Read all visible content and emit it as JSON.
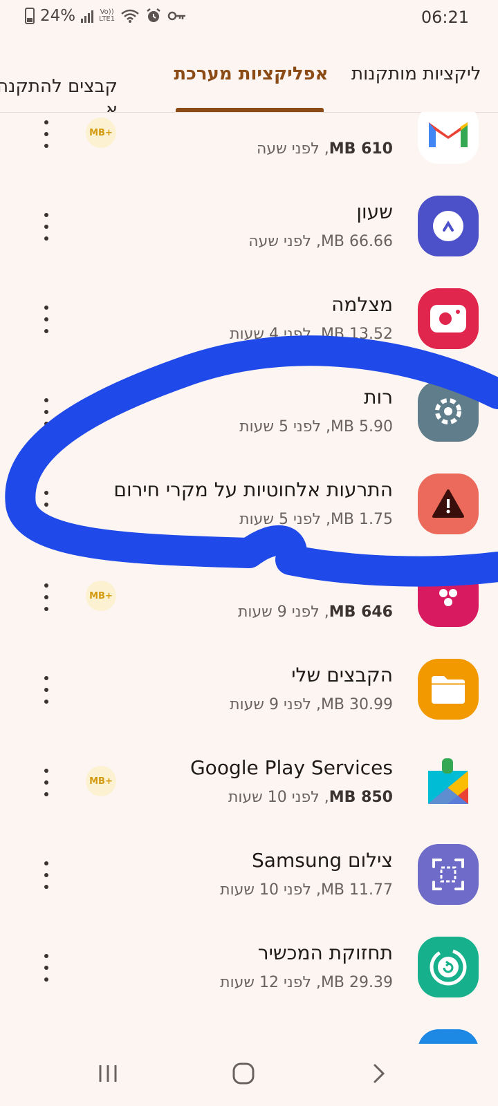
{
  "status_bar": {
    "battery": "24%",
    "volte": "Vo)) LTE1",
    "time": "06:21"
  },
  "tabs": [
    {
      "label": "ליקציות מותקנות",
      "selected": false
    },
    {
      "label": "אפליקציות מערכת",
      "selected": true
    },
    {
      "label": "קבצים להתקנה",
      "label2": "א",
      "selected": false
    }
  ],
  "apps": [
    {
      "name": "",
      "size": "610 MB",
      "time": ", לפני שעה",
      "size_bold": true,
      "badge": "MB+",
      "icon": "gmail-icon",
      "color": "#ffffff"
    },
    {
      "name": "שעון",
      "size": "66.66 MB",
      "time": ", לפני שעה",
      "size_bold": false,
      "badge": "",
      "icon": "clock-icon",
      "color": "#4c50c9"
    },
    {
      "name": "מצלמה",
      "size": "13.52 MB",
      "time": ", לפני 4 שעות",
      "size_bold": false,
      "badge": "",
      "icon": "camera-icon",
      "color": "#e0264c"
    },
    {
      "name": "רות",
      "size": "5.90 MB",
      "time": ", לפני 5 שעות",
      "size_bold": false,
      "badge": "",
      "icon": "settings-icon",
      "color": "#607d8b"
    },
    {
      "name": "התרעות אלחוטיות על מקרי חירום",
      "size": "1.75 MB",
      "time": ", לפני 5 שעות",
      "size_bold": false,
      "badge": "",
      "icon": "warning-icon",
      "color": "#ec6a5c"
    },
    {
      "name": "",
      "size": "646 MB",
      "time": ", לפני 9 שעות",
      "size_bold": true,
      "badge": "MB+",
      "icon": "gallery-icon",
      "color": "#d81b60"
    },
    {
      "name": "הקבצים שלי",
      "size": "30.99 MB",
      "time": ", לפני 9 שעות",
      "size_bold": false,
      "badge": "",
      "icon": "folder-icon",
      "color": "#f29900"
    },
    {
      "name": "Google Play Services",
      "size": "850 MB",
      "time": ", לפני 10 שעות",
      "size_bold": true,
      "badge": "MB+",
      "icon": "puzzle-icon",
      "color": "#ffffff"
    },
    {
      "name": "צילום Samsung",
      "size": "11.77 MB",
      "time": ", לפני 10 שעות",
      "size_bold": false,
      "badge": "",
      "icon": "screenshot-icon",
      "color": "#6f6bc9"
    },
    {
      "name": "תחזוקת המכשיר",
      "size": "29.39 MB",
      "time": ", לפני 12 שעות",
      "size_bold": false,
      "badge": "",
      "icon": "device-care-icon",
      "color": "#16b08c"
    }
  ],
  "colors": {
    "accent": "#8a4b17",
    "annotation": "#1f49e8",
    "background": "#fcf5f1"
  }
}
